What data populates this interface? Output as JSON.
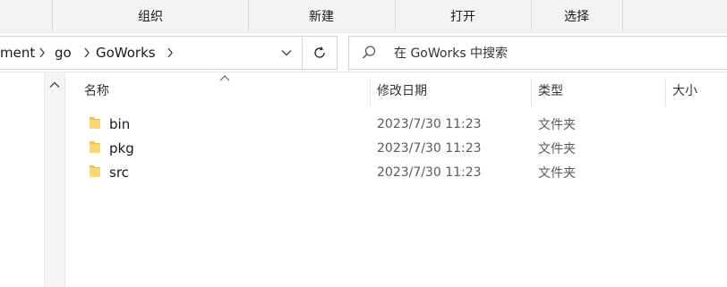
{
  "ribbon": {
    "groups": [
      "组织",
      "新建",
      "打开",
      "选择"
    ]
  },
  "address": {
    "crumbs": [
      "ment",
      "go",
      "GoWorks"
    ]
  },
  "search": {
    "placeholder": "在 GoWorks 中搜索"
  },
  "columns": {
    "name": "名称",
    "modified": "修改日期",
    "type": "类型",
    "size": "大小"
  },
  "files": [
    {
      "name": "bin",
      "modified": "2023/7/30 11:23",
      "type": "文件夹"
    },
    {
      "name": "pkg",
      "modified": "2023/7/30 11:23",
      "type": "文件夹"
    },
    {
      "name": "src",
      "modified": "2023/7/30 11:23",
      "type": "文件夹"
    }
  ],
  "colors": {
    "folder": "#f2c14e",
    "ribbon_bg": "#f3f3f3"
  },
  "icons": [
    "chevron-right-icon",
    "chevron-down-icon",
    "refresh-icon",
    "search-icon",
    "folder-icon",
    "sort-up-icon",
    "scroll-up-icon"
  ]
}
